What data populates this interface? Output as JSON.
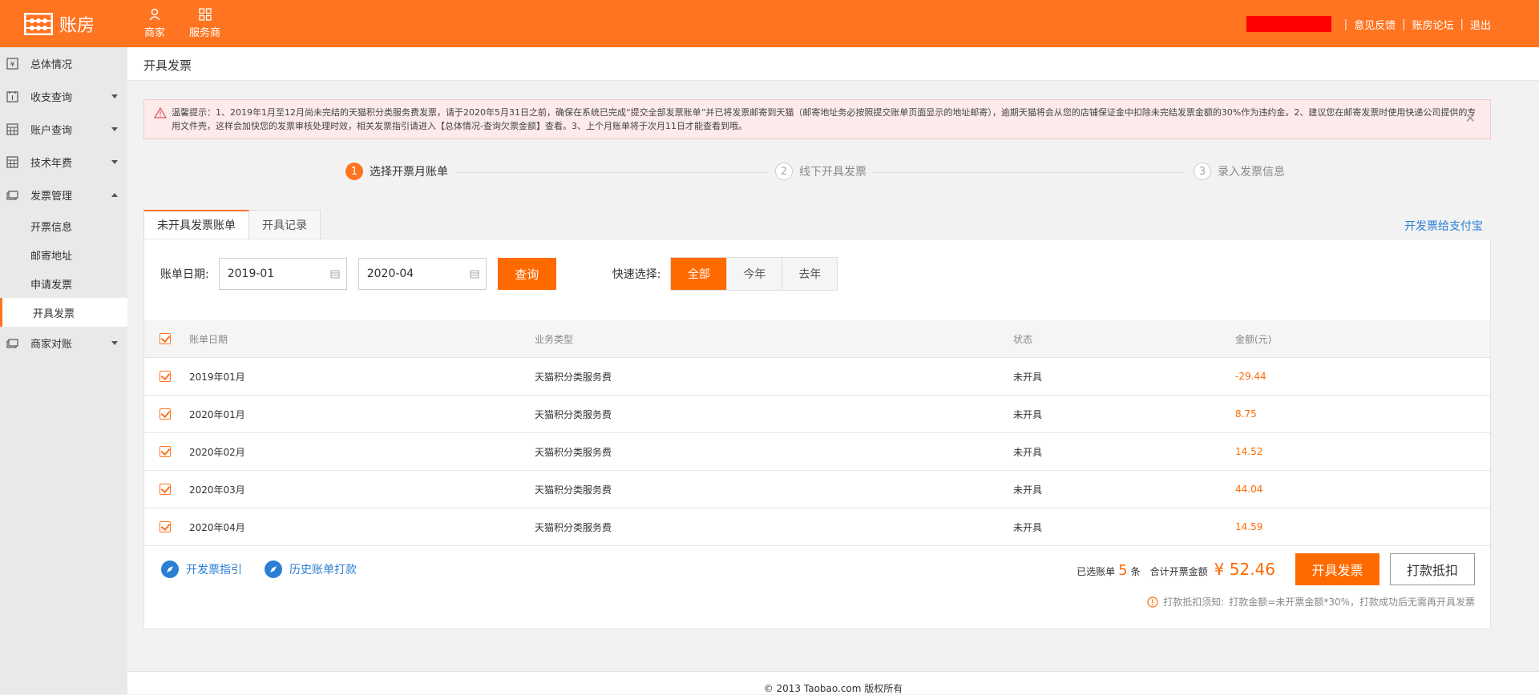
{
  "colors": {
    "brand": "#ff7420",
    "primary_button": "#ff6a00",
    "link": "#2a7fd4",
    "amount": "#ff6a00"
  },
  "header": {
    "logo_text": "账房",
    "nav": [
      {
        "label": "商家",
        "icon": "user-icon"
      },
      {
        "label": "服务商",
        "icon": "apps-icon"
      }
    ],
    "links": [
      "意见反馈",
      "账房论坛",
      "退出"
    ]
  },
  "sidebar": {
    "items": [
      {
        "label": "总体情况",
        "icon": "yen-icon"
      },
      {
        "label": "收支查询",
        "icon": "income-icon"
      },
      {
        "label": "账户查询",
        "icon": "calculator-icon"
      },
      {
        "label": "技术年费",
        "icon": "calculator-icon"
      },
      {
        "label": "发票管理",
        "icon": "invoice-icon"
      },
      {
        "label": "商家对账",
        "icon": "reconcile-icon"
      }
    ],
    "sub_items": [
      "开票信息",
      "邮寄地址",
      "申请发票",
      "开具发票"
    ]
  },
  "page": {
    "title": "开具发票"
  },
  "notice": {
    "text": "温馨提示：1、2019年1月至12月尚未完结的天猫积分类服务费发票，请于2020年5月31日之前，确保在系统已完成“提交全部发票账单”并已将发票邮寄到天猫（邮寄地址务必按照提交账单页面显示的地址邮寄），逾期天猫将会从您的店铺保证金中扣除未完结发票金额的30%作为违约金。2、建议您在邮寄发票时使用快递公司提供的专用文件壳，这样会加快您的发票审核处理时效，相关发票指引请进入【总体情况-查询欠票金额】查看。3、上个月账单将于次月11日才能查看到哦。"
  },
  "steps": [
    {
      "num": "1",
      "label": "选择开票月账单"
    },
    {
      "num": "2",
      "label": "线下开具发票"
    },
    {
      "num": "3",
      "label": "录入发票信息"
    }
  ],
  "tabs": [
    "未开具发票账单",
    "开具记录"
  ],
  "alipay_link": "开发票给支付宝",
  "filter": {
    "label": "账单日期:",
    "start": "2019-01",
    "end": "2020-04",
    "query_button": "查询",
    "quick_label": "快速选择:",
    "quick_options": [
      "全部",
      "今年",
      "去年"
    ]
  },
  "table": {
    "headers": [
      "账单日期",
      "业务类型",
      "状态",
      "金额(元)"
    ],
    "rows": [
      {
        "date": "2019年01月",
        "type": "天猫积分类服务费",
        "status": "未开具",
        "amount": "-29.44"
      },
      {
        "date": "2020年01月",
        "type": "天猫积分类服务费",
        "status": "未开具",
        "amount": "8.75"
      },
      {
        "date": "2020年02月",
        "type": "天猫积分类服务费",
        "status": "未开具",
        "amount": "14.52"
      },
      {
        "date": "2020年03月",
        "type": "天猫积分类服务费",
        "status": "未开具",
        "amount": "44.04"
      },
      {
        "date": "2020年04月",
        "type": "天猫积分类服务费",
        "status": "未开具",
        "amount": "14.59"
      }
    ]
  },
  "summary": {
    "guide_link": "开发票指引",
    "history_link": "历史账单打款",
    "selected_prefix": "已选账单",
    "selected_count": "5",
    "selected_suffix": "条",
    "total_label": "合计开票金额",
    "total_value": "¥ 52.46",
    "issue_button": "开具发票",
    "pay_button": "打款抵扣",
    "pay_note_label": "打款抵扣须知:",
    "pay_note": "打款金额=未开票金额*30%，打款成功后无需再开具发票"
  },
  "footer": {
    "copyright": "© 2013 Taobao.com 版权所有"
  }
}
